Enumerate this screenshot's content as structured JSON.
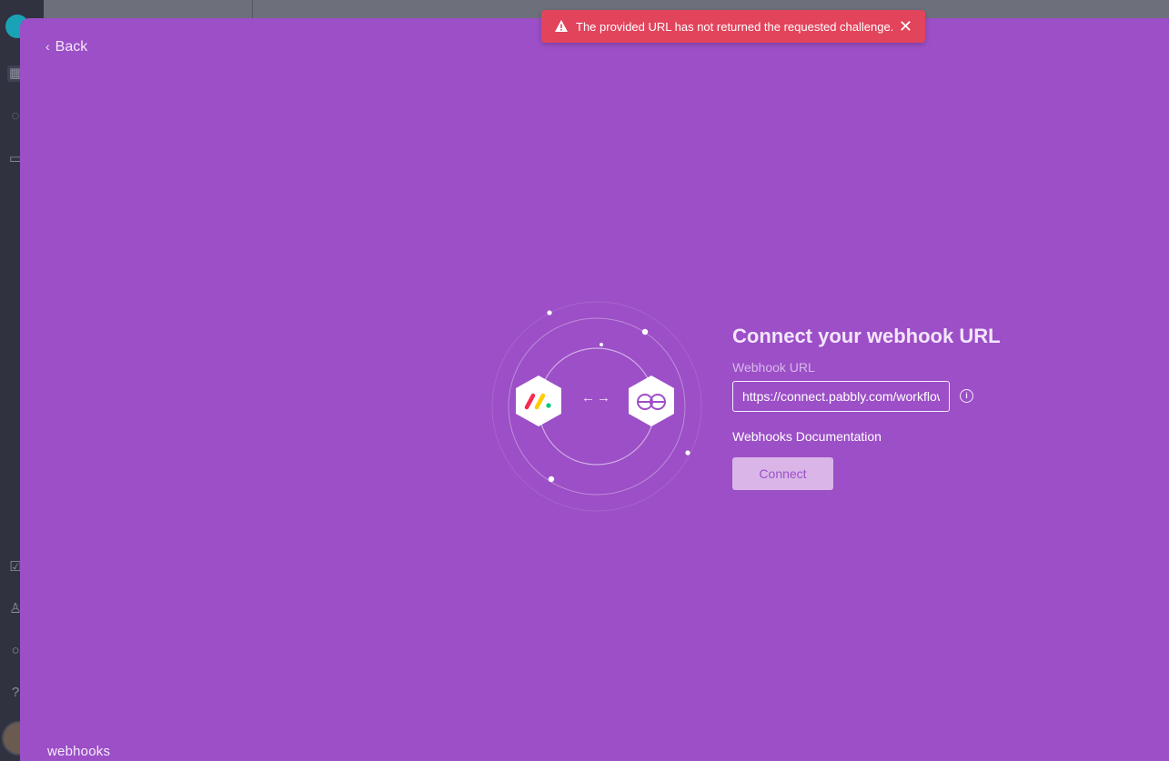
{
  "toast": {
    "message": "The provided URL has not returned the requested challenge.",
    "color": "#e2445c"
  },
  "modal": {
    "back_label": "Back",
    "title": "Connect your webhook URL",
    "field_label": "Webhook URL",
    "url_value": "https://connect.pabbly.com/workflow",
    "documentation_link": "Webhooks Documentation",
    "connect_label": "Connect",
    "brand": "webhooks",
    "background": "#9c4fc7"
  },
  "icons": {
    "warning": "warning-icon",
    "close": "close-icon",
    "back": "chevron-left-icon",
    "info": "info-icon",
    "monday": "monday-logo-icon",
    "webhooks": "webhooks-logo-icon",
    "arrows": "swap-arrows-icon"
  }
}
